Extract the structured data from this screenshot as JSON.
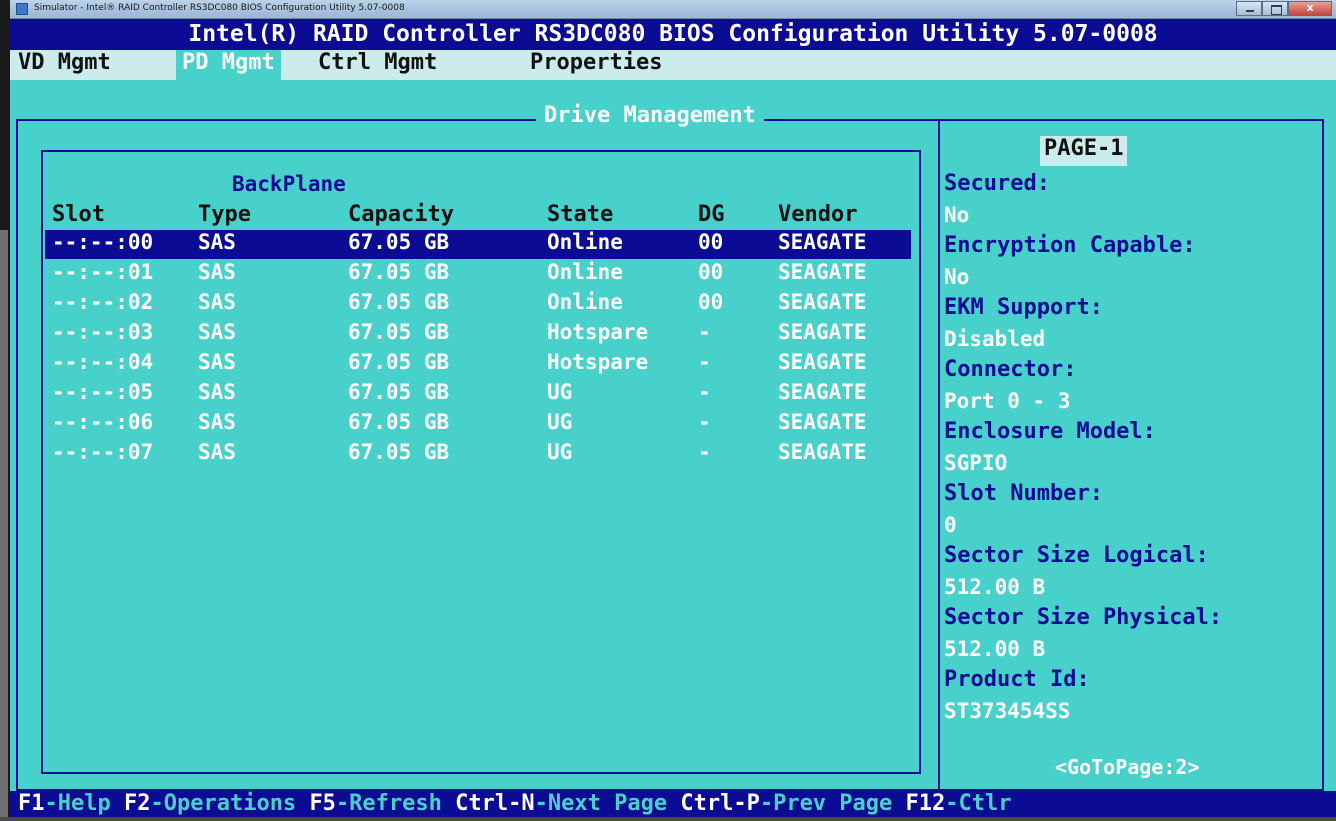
{
  "window": {
    "title": "Simulator - Intel® RAID Controller RS3DC080 BIOS Configuration Utility 5.07-0008"
  },
  "header": {
    "title": "Intel(R) RAID Controller RS3DC080 BIOS Configuration Utility 5.07-0008"
  },
  "menu": [
    {
      "label": "VD Mgmt",
      "active": false
    },
    {
      "label": "PD Mgmt",
      "active": true
    },
    {
      "label": "Ctrl Mgmt",
      "active": false
    },
    {
      "label": "Properties",
      "active": false
    }
  ],
  "drive_panel": {
    "title": "Drive Management",
    "group_label": "BackPlane",
    "columns": [
      "Slot",
      "Type",
      "Capacity",
      "State",
      "DG",
      "Vendor"
    ],
    "rows": [
      [
        "--:--:00",
        "SAS",
        "67.05 GB",
        "Online",
        "00",
        "SEAGATE"
      ],
      [
        "--:--:01",
        "SAS",
        "67.05 GB",
        "Online",
        "00",
        "SEAGATE"
      ],
      [
        "--:--:02",
        "SAS",
        "67.05 GB",
        "Online",
        "00",
        "SEAGATE"
      ],
      [
        "--:--:03",
        "SAS",
        "67.05 GB",
        "Hotspare",
        "-",
        "SEAGATE"
      ],
      [
        "--:--:04",
        "SAS",
        "67.05 GB",
        "Hotspare",
        "-",
        "SEAGATE"
      ],
      [
        "--:--:05",
        "SAS",
        "67.05 GB",
        "UG",
        "-",
        "SEAGATE"
      ],
      [
        "--:--:06",
        "SAS",
        "67.05 GB",
        "UG",
        "-",
        "SEAGATE"
      ],
      [
        "--:--:07",
        "SAS",
        "67.05 GB",
        "UG",
        "-",
        "SEAGATE"
      ]
    ],
    "selected_row": 0
  },
  "properties": {
    "page_title": "PAGE-1",
    "items": [
      {
        "label": "Secured:",
        "value": "No"
      },
      {
        "label": "Encryption Capable:",
        "value": "No"
      },
      {
        "label": "EKM Support:",
        "value": "Disabled"
      },
      {
        "label": "Connector:",
        "value": "Port 0 - 3"
      },
      {
        "label": "Enclosure Model:",
        "value": "SGPIO"
      },
      {
        "label": "Slot Number:",
        "value": "0"
      },
      {
        "label": "Sector Size Logical:",
        "value": "512.00 B"
      },
      {
        "label": "Sector Size Physical:",
        "value": "512.00 B"
      },
      {
        "label": "Product Id:",
        "value": "ST373454SS"
      }
    ],
    "goto_page": "<GoToPage:2>"
  },
  "function_keys": [
    {
      "key": "F1",
      "desc": "-Help "
    },
    {
      "key": "F2",
      "desc": "-Operations "
    },
    {
      "key": "F5",
      "desc": "-Refresh "
    },
    {
      "key": "Ctrl-N",
      "desc": "-Next Page "
    },
    {
      "key": "Ctrl-P",
      "desc": "-Prev Page "
    },
    {
      "key": "F12",
      "desc": "-Ctlr"
    }
  ],
  "colors": {
    "console_bg": "#48d1cb",
    "accent_blue": "#0b0b94",
    "menu_bg": "#ccebec",
    "text_white": "#ffffff"
  }
}
